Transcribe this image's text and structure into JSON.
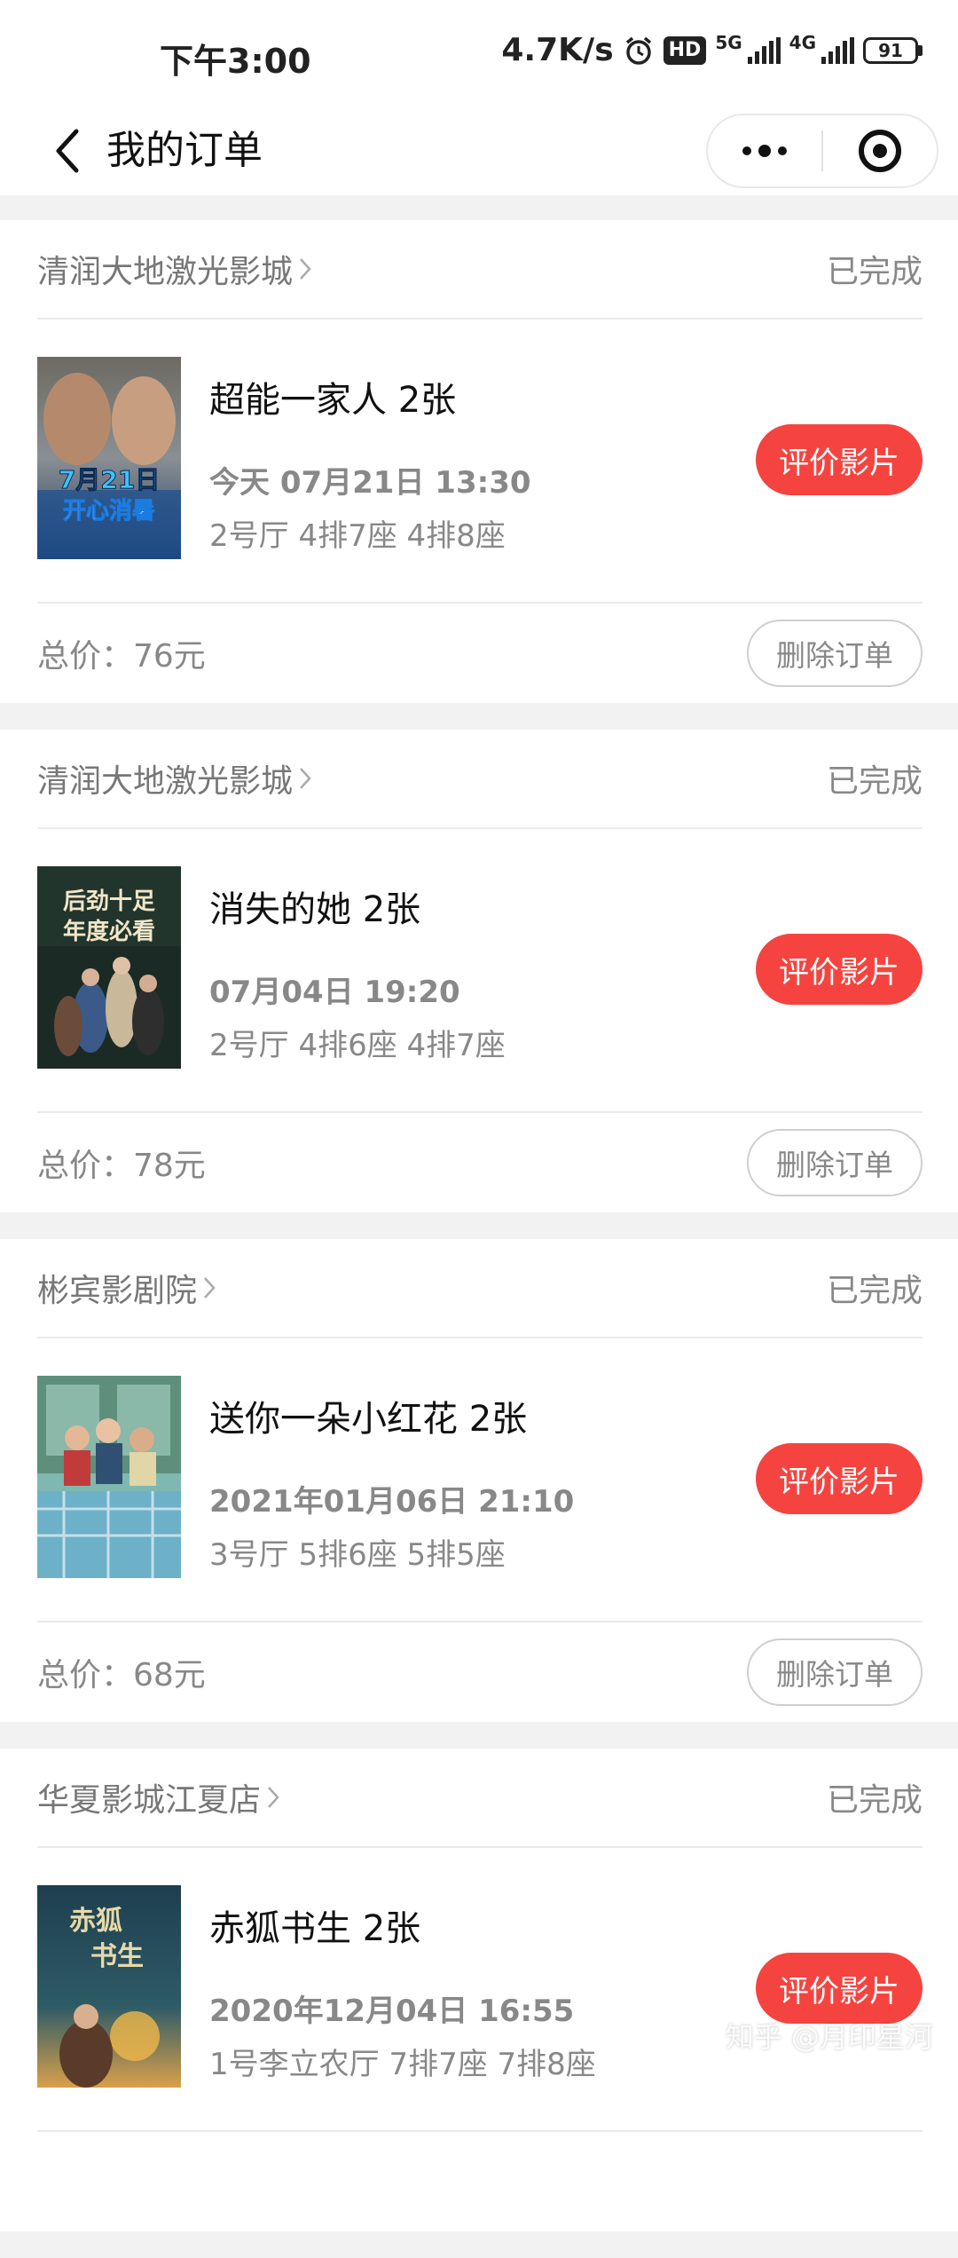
{
  "status_bar": {
    "time": "下午3:00",
    "speed": "4.7K/s",
    "hd": "HD",
    "net1": "5G",
    "net2": "4G",
    "battery": "91"
  },
  "nav": {
    "title": "我的订单"
  },
  "orders": [
    {
      "cinema": "清润大地激光影城",
      "status": "已完成",
      "title": "超能一家人 2张",
      "showtime": "今天 07月21日 13:30",
      "seats": "2号厅 4排7座 4排8座",
      "rate_label": "评价影片",
      "total": "总价：76元",
      "delete_label": "删除订单",
      "poster": {
        "line1": "7月21日",
        "line2": "开心消暑"
      }
    },
    {
      "cinema": "清润大地激光影城",
      "status": "已完成",
      "title": "消失的她 2张",
      "showtime": "07月04日 19:20",
      "seats": "2号厅 4排6座 4排7座",
      "rate_label": "评价影片",
      "total": "总价：78元",
      "delete_label": "删除订单",
      "poster": {
        "line1": "后劲十足",
        "line2": "年度必看"
      }
    },
    {
      "cinema": "彬宾影剧院",
      "status": "已完成",
      "title": "送你一朵小红花 2张",
      "showtime": "2021年01月06日 21:10",
      "seats": "3号厅 5排6座 5排5座",
      "rate_label": "评价影片",
      "total": "总价：68元",
      "delete_label": "删除订单",
      "poster": {
        "line1": "",
        "line2": ""
      }
    },
    {
      "cinema": "华夏影城江夏店",
      "status": "已完成",
      "title": "赤狐书生 2张",
      "showtime": "2020年12月04日 16:55",
      "seats": "1号李立农厅 7排7座 7排8座",
      "rate_label": "评价影片",
      "total": "",
      "delete_label": "",
      "poster": {
        "line1": "赤狐",
        "line2": "书生"
      }
    }
  ],
  "watermark": "知乎 @月印星河",
  "colors": {
    "accent": "#f5443f",
    "page_bg": "#f2f2f2",
    "muted_text": "#888888"
  }
}
